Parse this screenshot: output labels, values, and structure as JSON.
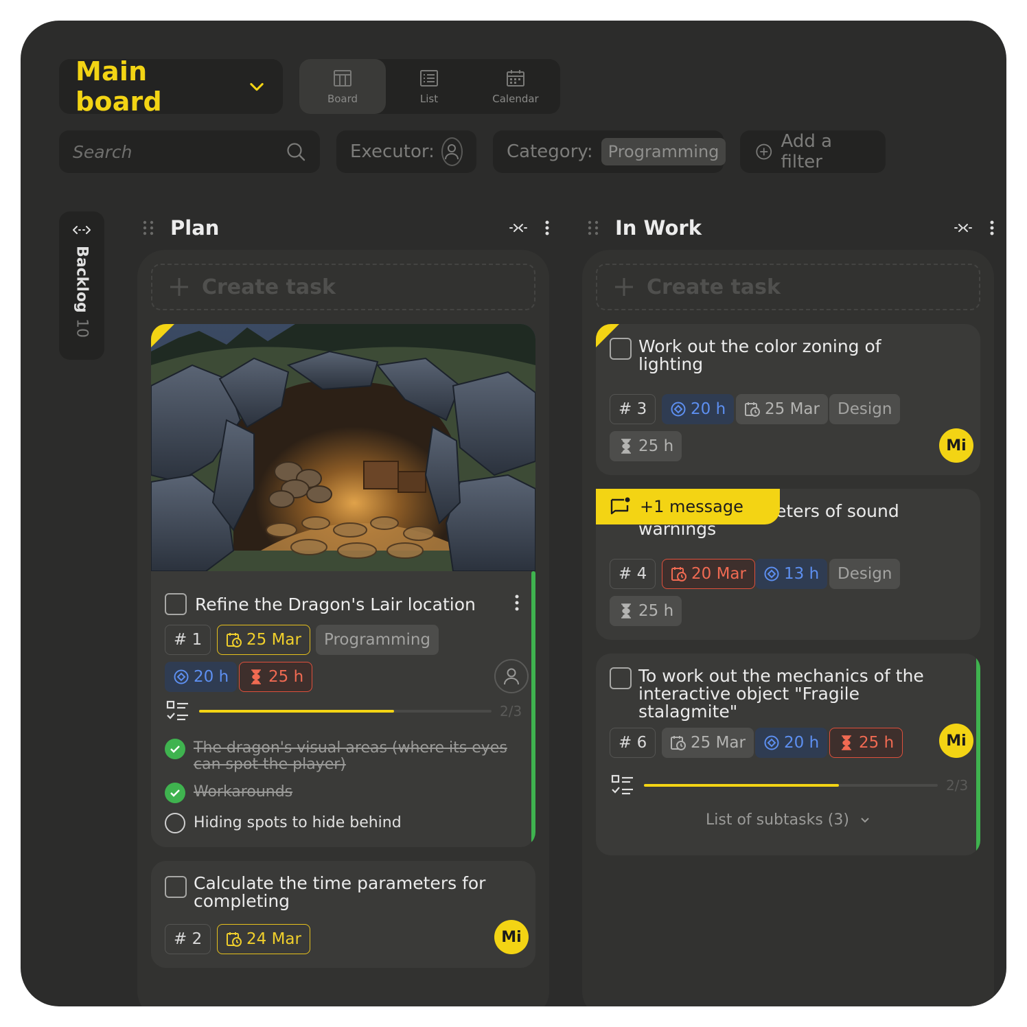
{
  "header": {
    "board_title": "Main board",
    "views": [
      {
        "label": "Board",
        "icon": "board-icon",
        "active": true
      },
      {
        "label": "List",
        "icon": "list-icon",
        "active": false
      },
      {
        "label": "Calendar",
        "icon": "calendar-icon",
        "active": false
      }
    ]
  },
  "filters": {
    "search_placeholder": "Search",
    "executor_label": "Executor:",
    "category_label": "Category:",
    "category_value": "Programming",
    "add_filter_label": "Add a filter"
  },
  "backlog": {
    "label": "Backlog",
    "count": "10"
  },
  "colors": {
    "accent": "#f3d414",
    "success": "#3fb34f",
    "danger": "#f06a52",
    "info": "#5d8ff0"
  },
  "columns": [
    {
      "name": "Plan",
      "create_label": "Create task",
      "cards": [
        {
          "title": "Refine the Dragon's Lair location",
          "id": "# 1",
          "date": "25 Mar",
          "category": "Programming",
          "estimate": "20 h",
          "duration": "25 h",
          "progress_text": "2/3",
          "progress": 0.667,
          "subtasks": [
            {
              "text": "The dragon's visual areas (where its eyes can spot the player)",
              "done": true
            },
            {
              "text": "Workarounds",
              "done": true
            },
            {
              "text": "Hiding spots to hide behind",
              "done": false
            }
          ]
        },
        {
          "title": "Calculate the time parameters for completing",
          "id": "# 2",
          "date": "24 Mar",
          "assignee": "Mi"
        }
      ]
    },
    {
      "name": "In Work",
      "create_label": "Create task",
      "cards": [
        {
          "title": "Work out the color zoning of lighting",
          "id": "# 3",
          "estimate": "20 h",
          "date": "25 Mar",
          "category": "Design",
          "duration": "25 h",
          "assignee": "Mi"
        },
        {
          "title_visible": "eters of sound",
          "title_line2": "warnings",
          "message": "+1 message",
          "id": "# 4",
          "date": "20 Mar",
          "estimate": "13 h",
          "category": "Design",
          "duration": "25 h"
        },
        {
          "title": "To work out the mechanics of the interactive object \"Fragile stalagmite\"",
          "id": "# 6",
          "date": "25 Mar",
          "estimate": "20 h",
          "duration": "25 h",
          "assignee": "Mi",
          "progress_text": "2/3",
          "progress": 0.667,
          "subtasks_toggle": "List of subtasks (3)"
        }
      ]
    }
  ]
}
